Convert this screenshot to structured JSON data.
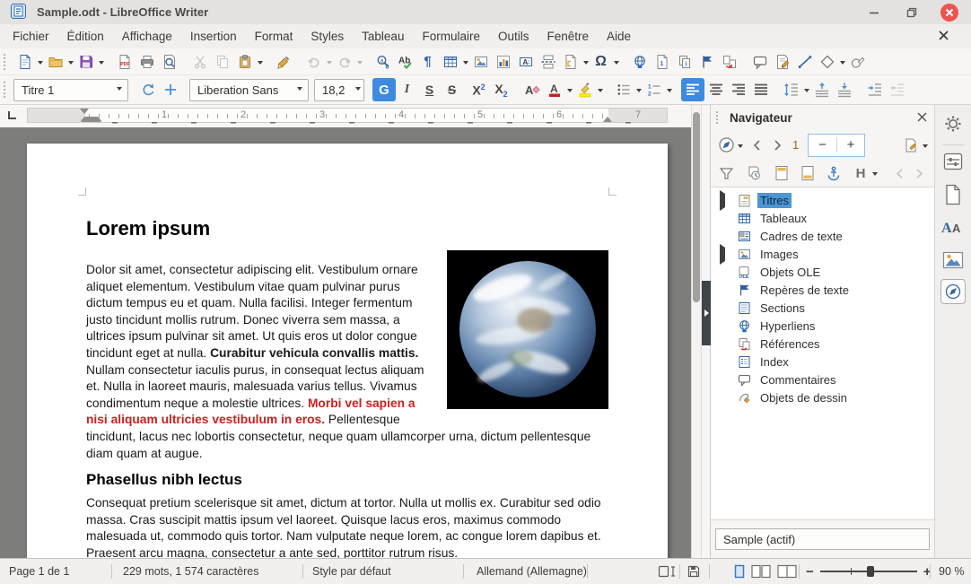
{
  "window": {
    "title": "Sample.odt - LibreOffice Writer"
  },
  "menubar": {
    "items": [
      "Fichier",
      "Édition",
      "Affichage",
      "Insertion",
      "Format",
      "Styles",
      "Tableau",
      "Formulaire",
      "Outils",
      "Fenêtre",
      "Aide"
    ]
  },
  "toolbars": {
    "paragraph_style": "Titre 1",
    "font_name": "Liberation Sans",
    "font_size": "18,2",
    "bold_label": "G",
    "italic_label": "I",
    "underline_label": "S",
    "strike_label": "S",
    "sup_base": "X",
    "sup_exp": "2",
    "sub_base": "X",
    "sub_exp": "2",
    "clear_label": "A",
    "fontcolor_label": "A",
    "standard_icons": [
      "new-document",
      "open",
      "save",
      "export-pdf",
      "print",
      "print-preview",
      "cut",
      "copy",
      "paste",
      "clone-formatting",
      "undo",
      "redo",
      "find-replace",
      "spelling",
      "formatting-marks",
      "insert-table",
      "insert-image",
      "insert-chart",
      "insert-text-box",
      "page-break",
      "insert-field",
      "special-character",
      "hyperlink",
      "footnote",
      "endnote",
      "bookmark",
      "cross-reference",
      "comment",
      "track-changes",
      "insert-line",
      "basic-shapes",
      "draw-functions"
    ],
    "formatting_icons": [
      "update-style",
      "new-style",
      "bold",
      "italic",
      "underline",
      "strikethrough",
      "superscript",
      "subscript",
      "clear-formatting",
      "font-color",
      "highlight-color",
      "bullet-list",
      "numbered-list",
      "align-left",
      "align-center",
      "align-right",
      "justify",
      "line-spacing",
      "increase-paragraph-spacing",
      "decrease-paragraph-spacing",
      "increase-indent",
      "decrease-indent"
    ],
    "spelling_label": "Ab",
    "pilcrow": "¶",
    "omega": "Ω"
  },
  "ruler": {
    "numbers": [
      "1",
      "2",
      "3",
      "4",
      "5",
      "6",
      "7"
    ]
  },
  "document": {
    "heading1": "Lorem ipsum",
    "para1": {
      "run_normal1": "Dolor sit amet, consectetur adipiscing elit. Vestibulum ornare aliquet elementum. Vestibulum vitae quam pulvinar purus dictum tempus eu et quam. Nulla facilisi. Integer fermentum justo tincidunt mollis rutrum. Donec viverra sem massa, a ultrices ipsum pulvinar sit amet. Ut quis eros ut dolor congue tincidunt eget at nulla. ",
      "run_bold": "Curabitur vehicula convallis mattis.",
      "run_normal2": " Nullam consectetur iaculis purus, in consequat lectus aliquam et. Nulla in laoreet mauris, malesuada varius tellus. Vivamus condimentum neque a molestie ultrices. ",
      "run_red_bold": "Morbi vel sapien a nisi aliquam ultricies vestibulum in eros.",
      "run_normal3": " Pellentesque tincidunt, lacus nec lobortis consectetur, neque quam ullamcorper urna, dictum pellentesque diam quam at augue."
    },
    "heading2": "Phasellus nibh lectus",
    "para2": "Consequat pretium scelerisque sit amet, dictum at tortor. Nulla ut mollis ex. Curabitur sed odio massa. Cras suscipit mattis ipsum vel laoreet. Quisque lacus eros, maximus commodo malesuada ut, commodo quis tortor. Nam vulputate neque lorem, ac congue lorem dapibus et. Praesent arcu magna, consectetur a ante sed, porttitor rutrum risus."
  },
  "navigator": {
    "title": "Navigateur",
    "page_number": "1",
    "spin_minus": "−",
    "spin_plus": "+",
    "heading_level_label": "H",
    "toolbar_icons": [
      "navigation",
      "previous-page",
      "next-page",
      "page-spinner",
      "drag-mode",
      "filter",
      "reminder",
      "header",
      "footer",
      "anchor",
      "heading-levels",
      "promote",
      "demote"
    ],
    "tree": [
      {
        "label": "Titres",
        "expandable": true,
        "selected": true
      },
      {
        "label": "Tableaux"
      },
      {
        "label": "Cadres de texte"
      },
      {
        "label": "Images",
        "expandable": true
      },
      {
        "label": "Objets OLE"
      },
      {
        "label": "Repères de texte"
      },
      {
        "label": "Sections"
      },
      {
        "label": "Hyperliens"
      },
      {
        "label": "Références"
      },
      {
        "label": "Index"
      },
      {
        "label": "Commentaires"
      },
      {
        "label": "Objets de dessin"
      }
    ],
    "active_document": "Sample (actif)"
  },
  "sidebar_tabs": [
    "sidebar-settings",
    "properties",
    "page",
    "styles",
    "gallery",
    "navigator"
  ],
  "statusbar": {
    "page": "Page 1 de 1",
    "word_count": "229 mots, 1 574 caractères",
    "page_style": "Style par défaut",
    "language": "Allemand (Allemagne)",
    "zoom_minus": "−",
    "zoom_plus": "+",
    "zoom_value": "90 %"
  },
  "colors": {
    "accent_blue": "#3e8ae0",
    "selection_blue": "#4d96d4",
    "document_red": "#c9211e",
    "canvas_gray": "#7d7d7b",
    "close_button_red": "#ef5350",
    "save_icon_purple": "#8d56b4"
  }
}
